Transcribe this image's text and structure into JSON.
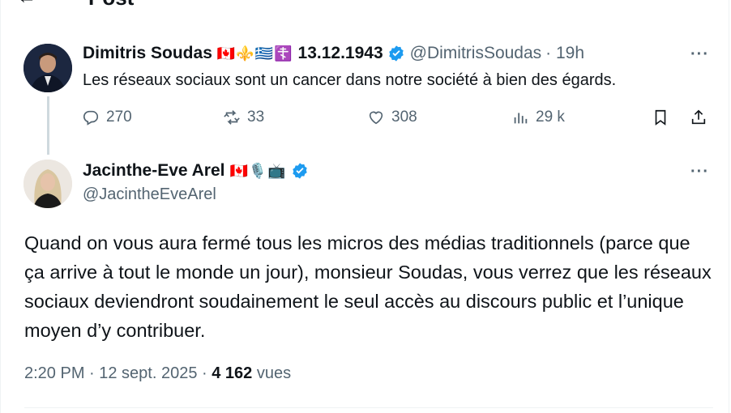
{
  "header": {
    "title": "Post"
  },
  "tweet1": {
    "name": "Dimitris Soudas",
    "emoji": "🇨🇦⚜️🇬🇷☦️",
    "date_tag": "13.12.1943",
    "handle": "@DimitrisSoudas",
    "time": "· 19h",
    "text": "Les réseaux sociaux sont un cancer dans notre société à bien des égards.",
    "replies": "270",
    "reposts": "33",
    "likes": "308",
    "views": "29 k"
  },
  "tweet2": {
    "name": "Jacinthe-Eve Arel",
    "emoji": "🇨🇦🎙️📺",
    "handle": "@JacintheEveArel",
    "text": "Quand on vous aura fermé tous les micros des médias traditionnels (parce que ça arrive à tout le monde un jour), monsieur Soudas, vous verrez que les réseaux sociaux deviendront soudainement le seul accès au discours public et l’unique moyen d’y contribuer.",
    "time": "2:20 PM · 12 sept. 2025 · ",
    "views_count": "4 162",
    "views_label": " vues"
  },
  "more_label": "···",
  "colors": {
    "verified": "#1d9bf0",
    "muted": "#536471"
  }
}
